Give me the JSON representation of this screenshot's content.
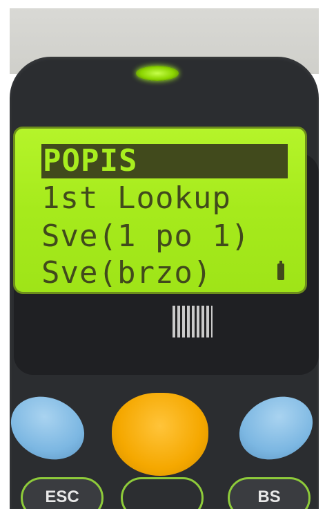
{
  "device": {
    "type": "handheld barcode scanner",
    "led_color": "#a6f02a",
    "lcd_color": "#a6ea1c",
    "lcd_text_color": "#414a1c"
  },
  "screen": {
    "menu_items": [
      {
        "label": "POPIS",
        "selected": true
      },
      {
        "label": "1st Lookup",
        "selected": false
      },
      {
        "label": "Sve(1 po 1)",
        "selected": false
      },
      {
        "label": "Sve(brzo)",
        "selected": false
      }
    ],
    "battery_icon": "battery-icon"
  },
  "keys": {
    "esc_label": "ESC",
    "bs_label": "BS",
    "scan_key_color": "#f5a800",
    "side_keys_color": "#7cb7e2"
  }
}
